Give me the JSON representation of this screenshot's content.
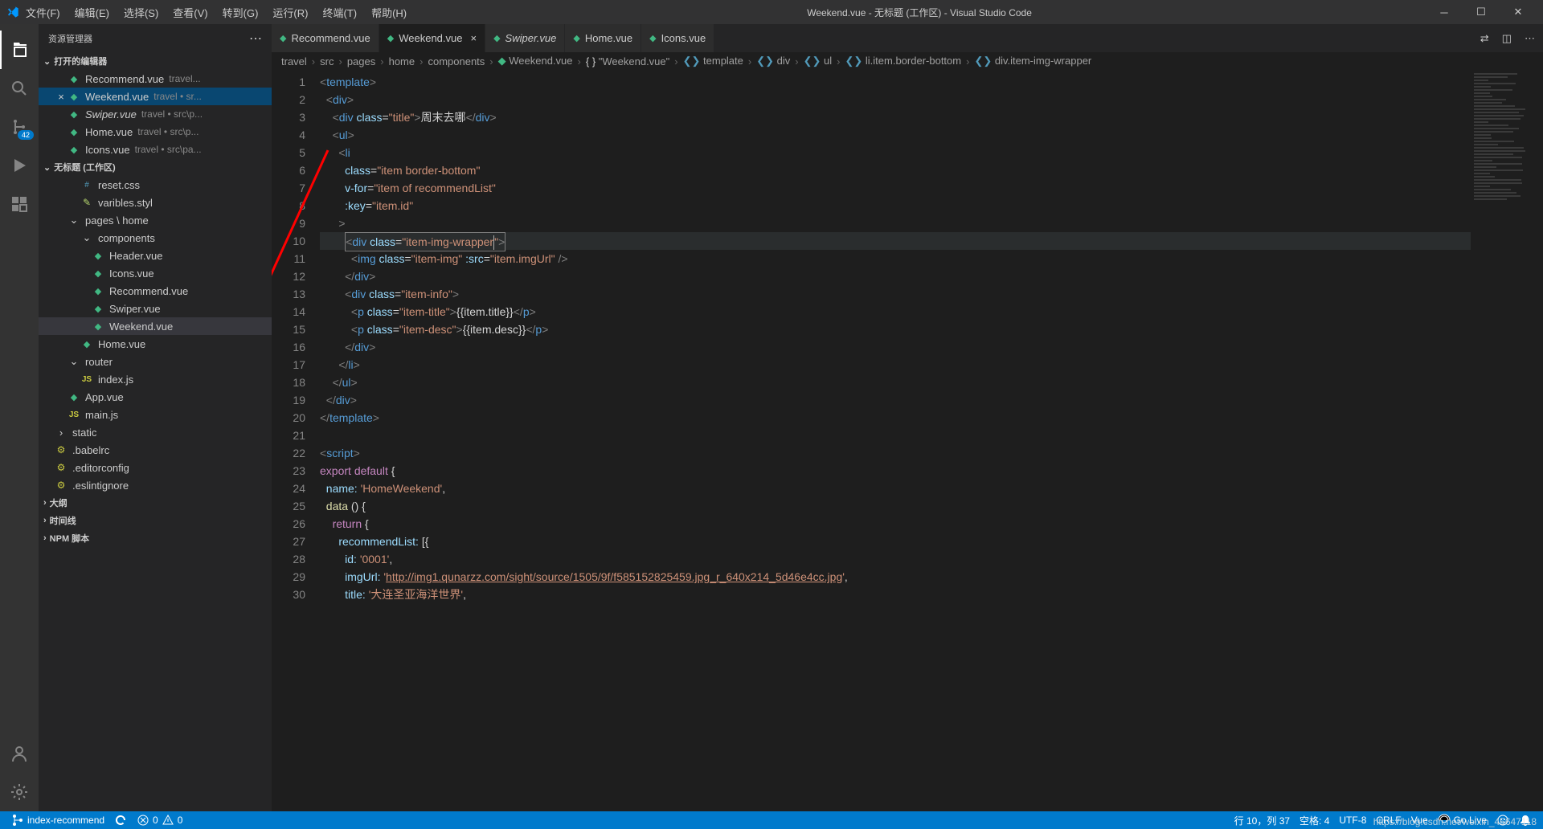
{
  "title": "Weekend.vue - 无标题 (工作区) - Visual Studio Code",
  "menu": [
    "文件(F)",
    "编辑(E)",
    "选择(S)",
    "查看(V)",
    "转到(G)",
    "运行(R)",
    "终端(T)",
    "帮助(H)"
  ],
  "sidebar": {
    "header": "资源管理器",
    "openEditorsLabel": "打开的编辑器",
    "workspaceLabel": "无标题 (工作区)",
    "outlineLabel": "大纲",
    "timelineLabel": "时间线",
    "npmLabel": "NPM 脚本",
    "scmBadge": "42"
  },
  "openEditors": [
    {
      "name": "Recommend.vue",
      "detail": "travel...",
      "close": ""
    },
    {
      "name": "Weekend.vue",
      "detail": "travel • sr...",
      "close": "×",
      "active": true
    },
    {
      "name": "Swiper.vue",
      "detail": "travel • src\\p...",
      "close": "",
      "italic": true
    },
    {
      "name": "Home.vue",
      "detail": "travel • src\\p...",
      "close": ""
    },
    {
      "name": "Icons.vue",
      "detail": "travel • src\\pa...",
      "close": ""
    }
  ],
  "tree": [
    {
      "type": "file",
      "name": "reset.css",
      "icon": "css",
      "indent": 3
    },
    {
      "type": "file",
      "name": "varibles.styl",
      "icon": "styl",
      "indent": 3
    },
    {
      "type": "folder",
      "name": "pages \\ home",
      "indent": 2,
      "open": true
    },
    {
      "type": "folder",
      "name": "components",
      "indent": 3,
      "open": true
    },
    {
      "type": "file",
      "name": "Header.vue",
      "icon": "vue",
      "indent": 4
    },
    {
      "type": "file",
      "name": "Icons.vue",
      "icon": "vue",
      "indent": 4
    },
    {
      "type": "file",
      "name": "Recommend.vue",
      "icon": "vue",
      "indent": 4
    },
    {
      "type": "file",
      "name": "Swiper.vue",
      "icon": "vue",
      "indent": 4
    },
    {
      "type": "file",
      "name": "Weekend.vue",
      "icon": "vue",
      "indent": 4,
      "selected": true
    },
    {
      "type": "file",
      "name": "Home.vue",
      "icon": "vue",
      "indent": 3
    },
    {
      "type": "folder",
      "name": "router",
      "indent": 2,
      "open": true
    },
    {
      "type": "file",
      "name": "index.js",
      "icon": "js",
      "indent": 3
    },
    {
      "type": "file",
      "name": "App.vue",
      "icon": "vue",
      "indent": 2
    },
    {
      "type": "file",
      "name": "main.js",
      "icon": "js",
      "indent": 2
    },
    {
      "type": "folder",
      "name": "static",
      "indent": 1,
      "open": false
    },
    {
      "type": "file",
      "name": ".babelrc",
      "icon": "cfg",
      "indent": 1
    },
    {
      "type": "file",
      "name": ".editorconfig",
      "icon": "cfg",
      "indent": 1
    },
    {
      "type": "file",
      "name": ".eslintignore",
      "icon": "cfg",
      "indent": 1
    }
  ],
  "tabs": [
    {
      "name": "Recommend.vue"
    },
    {
      "name": "Weekend.vue",
      "active": true,
      "close": "×"
    },
    {
      "name": "Swiper.vue",
      "italic": true
    },
    {
      "name": "Home.vue"
    },
    {
      "name": "Icons.vue"
    }
  ],
  "breadcrumb": [
    "travel",
    "src",
    "pages",
    "home",
    "components",
    "Weekend.vue",
    "\"Weekend.vue\"",
    "template",
    "div",
    "ul",
    "li.item.border-bottom",
    "div.item-img-wrapper"
  ],
  "code": {
    "lines": [
      {
        "n": 1,
        "html": "<span class='tag'>&lt;</span><span class='tagname'>template</span><span class='tag'>&gt;</span>"
      },
      {
        "n": 2,
        "html": "  <span class='tag'>&lt;</span><span class='tagname'>div</span><span class='tag'>&gt;</span>"
      },
      {
        "n": 3,
        "html": "    <span class='tag'>&lt;</span><span class='tagname'>div</span> <span class='attr'>class</span><span class='punct'>=</span><span class='str'>\"title\"</span><span class='tag'>&gt;</span><span class='txt'>周末去哪</span><span class='tag'>&lt;/</span><span class='tagname'>div</span><span class='tag'>&gt;</span>"
      },
      {
        "n": 4,
        "html": "    <span class='tag'>&lt;</span><span class='tagname'>ul</span><span class='tag'>&gt;</span>"
      },
      {
        "n": 5,
        "html": "      <span class='tag'>&lt;</span><span class='tagname'>li</span>"
      },
      {
        "n": 6,
        "html": "        <span class='attr'>class</span><span class='punct'>=</span><span class='str'>\"item border-bottom\"</span>"
      },
      {
        "n": 7,
        "html": "        <span class='attr'>v-for</span><span class='punct'>=</span><span class='str'>\"item of recommendList\"</span>"
      },
      {
        "n": 8,
        "html": "        <span class='attr'>:key</span><span class='punct'>=</span><span class='str'>\"item.id\"</span>"
      },
      {
        "n": 9,
        "html": "      <span class='tag'>&gt;</span>"
      },
      {
        "n": 10,
        "hl": true,
        "html": "        <span class='cursor-box'><span class='tag'>&lt;</span><span class='tagname'>div</span> <span class='attr'>class</span><span class='punct'>=</span><span class='str'>\"item-img-wrapper<span class='caret'></span>\"</span><span class='tag'>&gt;</span></span>"
      },
      {
        "n": 11,
        "html": "          <span class='tag'>&lt;</span><span class='tagname'>img</span> <span class='attr'>class</span><span class='punct'>=</span><span class='str'>\"item-img\"</span> <span class='attr'>:src</span><span class='punct'>=</span><span class='str'>\"item.imgUrl\"</span> <span class='tag'>/&gt;</span>"
      },
      {
        "n": 12,
        "html": "        <span class='tag'>&lt;/</span><span class='tagname'>div</span><span class='tag'>&gt;</span>"
      },
      {
        "n": 13,
        "html": "        <span class='tag'>&lt;</span><span class='tagname'>div</span> <span class='attr'>class</span><span class='punct'>=</span><span class='str'>\"item-info\"</span><span class='tag'>&gt;</span>"
      },
      {
        "n": 14,
        "html": "          <span class='tag'>&lt;</span><span class='tagname'>p</span> <span class='attr'>class</span><span class='punct'>=</span><span class='str'>\"item-title\"</span><span class='tag'>&gt;</span><span class='txt'>{{item.title}}</span><span class='tag'>&lt;/</span><span class='tagname'>p</span><span class='tag'>&gt;</span>"
      },
      {
        "n": 15,
        "html": "          <span class='tag'>&lt;</span><span class='tagname'>p</span> <span class='attr'>class</span><span class='punct'>=</span><span class='str'>\"item-desc\"</span><span class='tag'>&gt;</span><span class='txt'>{{item.desc}}</span><span class='tag'>&lt;/</span><span class='tagname'>p</span><span class='tag'>&gt;</span>"
      },
      {
        "n": 16,
        "html": "        <span class='tag'>&lt;/</span><span class='tagname'>div</span><span class='tag'>&gt;</span>"
      },
      {
        "n": 17,
        "html": "      <span class='tag'>&lt;/</span><span class='tagname'>li</span><span class='tag'>&gt;</span>"
      },
      {
        "n": 18,
        "html": "    <span class='tag'>&lt;/</span><span class='tagname'>ul</span><span class='tag'>&gt;</span>"
      },
      {
        "n": 19,
        "html": "  <span class='tag'>&lt;/</span><span class='tagname'>div</span><span class='tag'>&gt;</span>"
      },
      {
        "n": 20,
        "html": "<span class='tag'>&lt;/</span><span class='tagname'>template</span><span class='tag'>&gt;</span>"
      },
      {
        "n": 21,
        "html": ""
      },
      {
        "n": 22,
        "html": "<span class='tag'>&lt;</span><span class='tagname'>script</span><span class='tag'>&gt;</span>"
      },
      {
        "n": 23,
        "html": "<span class='kw2'>export</span> <span class='kw2'>default</span> <span class='punct'>{</span>"
      },
      {
        "n": 24,
        "html": "  <span class='prop'>name:</span> <span class='str'>'HomeWeekend'</span><span class='punct'>,</span>"
      },
      {
        "n": 25,
        "html": "  <span class='fn'>data</span> <span class='punct'>() {</span>"
      },
      {
        "n": 26,
        "html": "    <span class='kw2'>return</span> <span class='punct'>{</span>"
      },
      {
        "n": 27,
        "html": "      <span class='prop'>recommendList:</span> <span class='punct'>[{</span>"
      },
      {
        "n": 28,
        "html": "        <span class='prop'>id:</span> <span class='str'>'0001'</span><span class='punct'>,</span>"
      },
      {
        "n": 29,
        "html": "        <span class='prop'>imgUrl:</span> <span class='str'>'<u>http://img1.qunarzz.com/sight/source/1505/9f/f585152825459.jpg_r_640x214_5d46e4cc.jpg</u>'</span><span class='punct'>,</span>"
      },
      {
        "n": 30,
        "html": "        <span class='prop'>title:</span> <span class='str'>'大连圣亚海洋世界'</span><span class='punct'>,</span>"
      }
    ]
  },
  "status": {
    "branch": "index-recommend",
    "errors": "0",
    "warnings": "0",
    "lineCol": "行 10，列 37",
    "spaces": "空格: 4",
    "encoding": "UTF-8",
    "eol": "CRLF",
    "lang": "Vue",
    "golive": "Go Live",
    "bell": "",
    "watermark": "https://blog.csdn.net/weixin_45647118"
  }
}
